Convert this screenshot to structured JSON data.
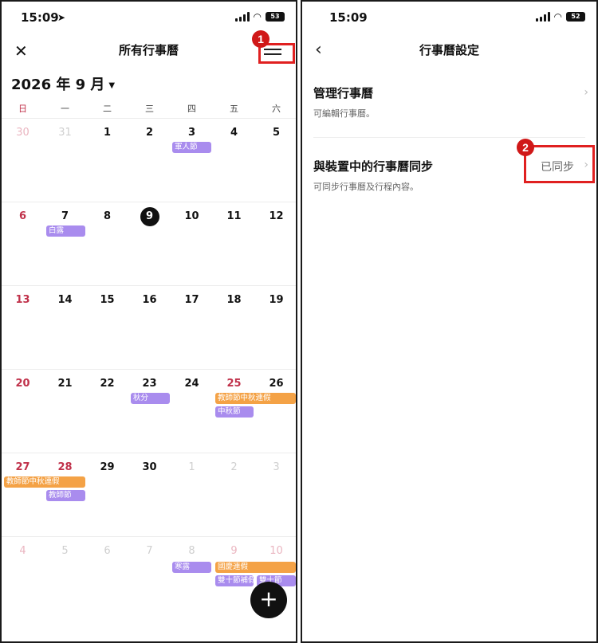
{
  "left": {
    "status": {
      "time": "15:09",
      "battery": "53"
    },
    "header": {
      "title": "所有行事曆",
      "close_icon": "close-icon",
      "menu_icon": "menu-icon"
    },
    "annotation_badge": "1",
    "month_label": "2026 年 9 月",
    "weekdays": [
      "日",
      "一",
      "二",
      "三",
      "四",
      "五",
      "六"
    ],
    "weeks": [
      [
        "30",
        "31",
        "1",
        "2",
        "3",
        "4",
        "5"
      ],
      [
        "6",
        "7",
        "8",
        "9",
        "10",
        "11",
        "12"
      ],
      [
        "13",
        "14",
        "15",
        "16",
        "17",
        "18",
        "19"
      ],
      [
        "20",
        "21",
        "22",
        "23",
        "24",
        "25",
        "26"
      ],
      [
        "27",
        "28",
        "29",
        "30",
        "1",
        "2",
        "3"
      ],
      [
        "4",
        "5",
        "6",
        "7",
        "8",
        "9",
        "10"
      ]
    ],
    "today": "9",
    "events": {
      "armed_forces_day": "軍人節",
      "white_dew": "白露",
      "autumn_equinox": "秋分",
      "teachers_day_holiday": "教師節中秋連假",
      "mid_autumn": "中秋節",
      "teachers_day_holiday_2": "教師節中秋連假",
      "teachers_day": "教師節",
      "cold_dew": "寒露",
      "national_day_holiday": "國慶連假",
      "double_ten_makeup": "雙十節補假",
      "double_ten": "雙十節"
    },
    "add_button": "+"
  },
  "right": {
    "status": {
      "time": "15:09",
      "battery": "52"
    },
    "header": {
      "title": "行事曆設定",
      "back_icon": "chevron-left-icon"
    },
    "manage": {
      "title": "管理行事曆",
      "subtitle": "可編輯行事曆。"
    },
    "sync": {
      "title": "與裝置中的行事曆同步",
      "subtitle": "可同步行事曆及行程內容。",
      "value": "已同步"
    },
    "annotation_badge": "2"
  },
  "colors": {
    "event_purple": "#a98cee",
    "event_orange": "#f4a246",
    "holiday_red": "#c0314a",
    "annotation_red": "#e02020"
  }
}
